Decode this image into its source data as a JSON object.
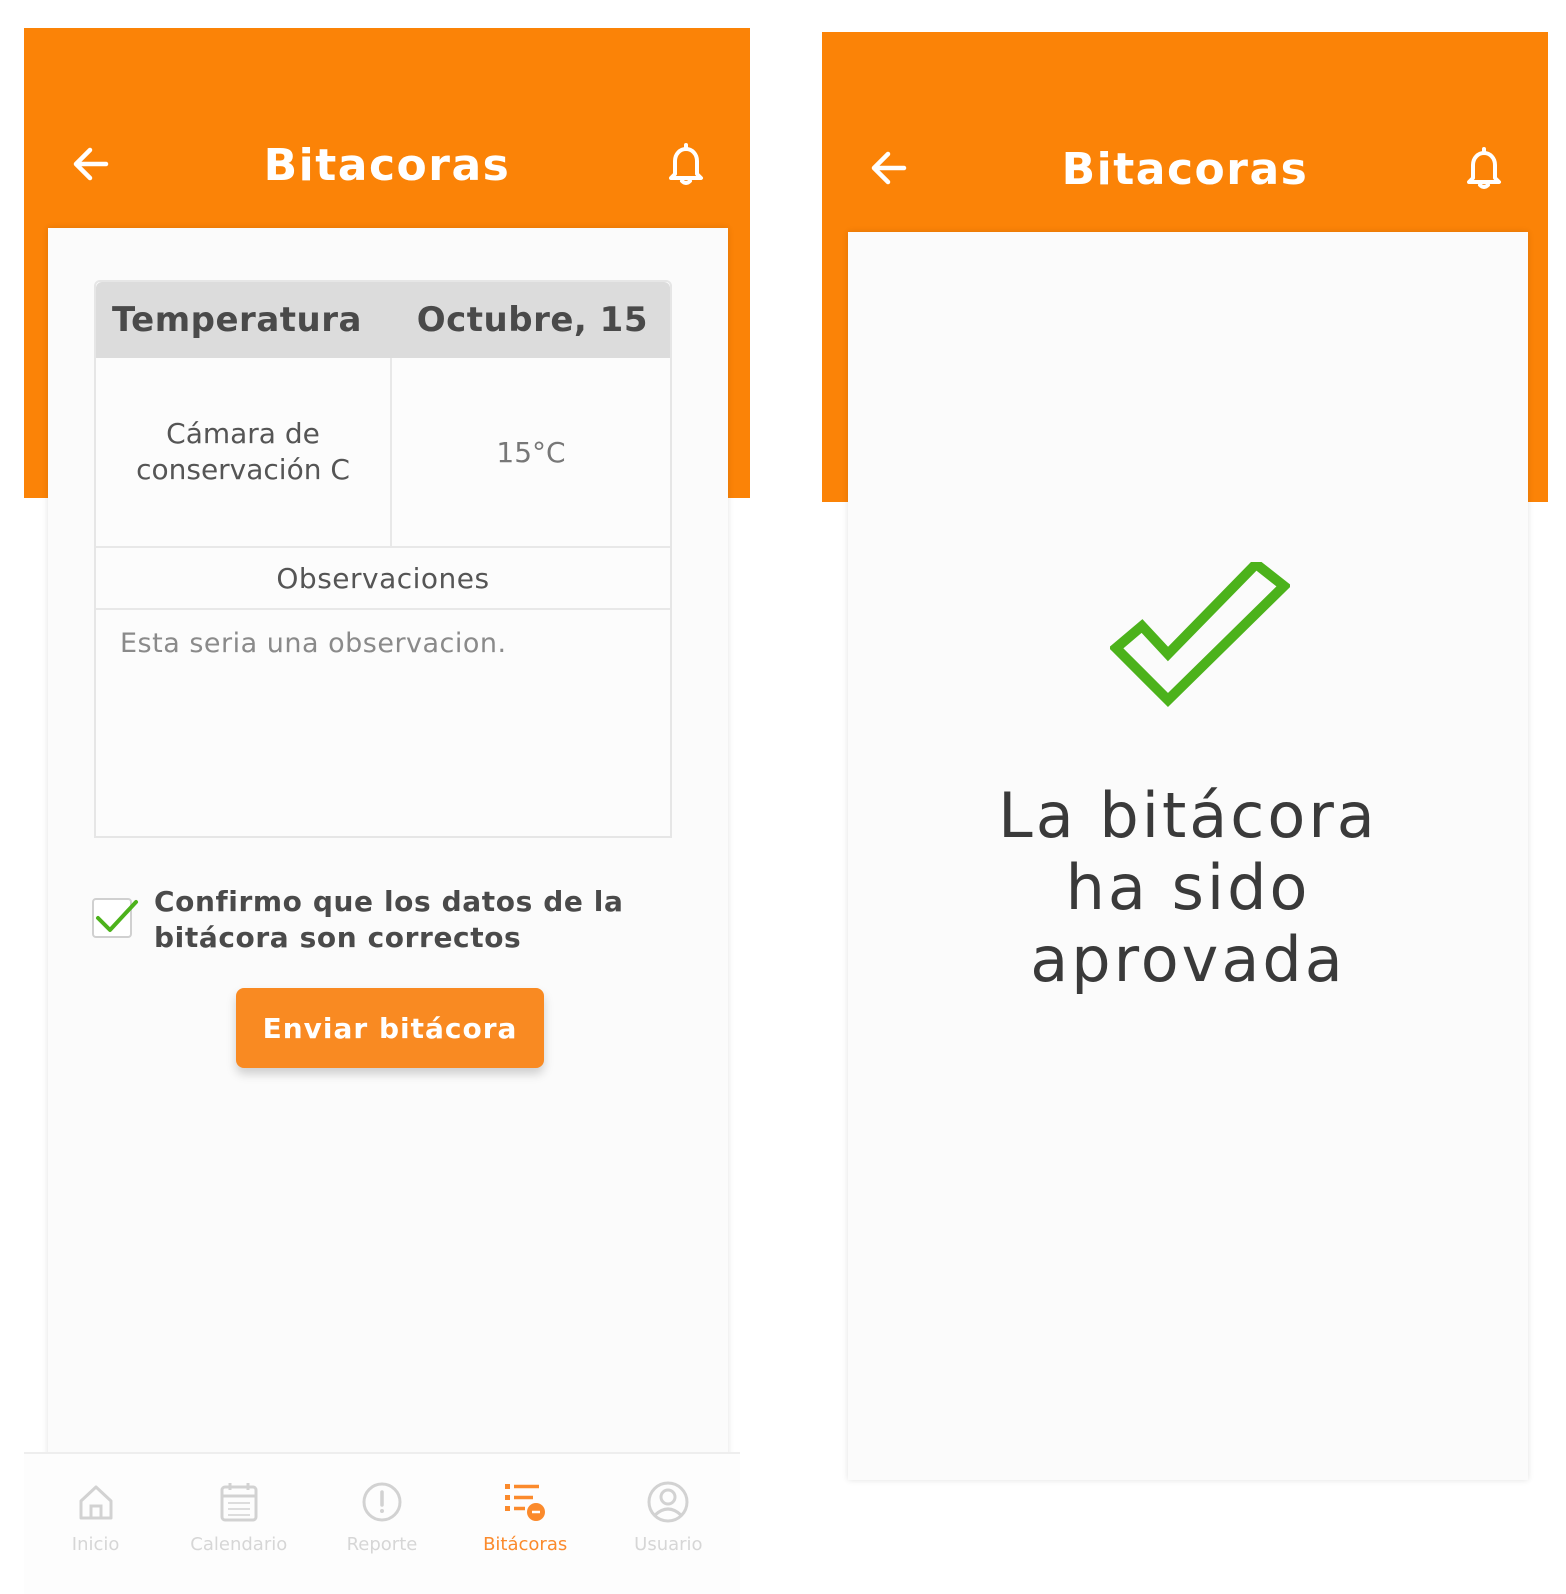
{
  "screens": [
    {
      "header": {
        "title": "Bitacoras"
      },
      "log": {
        "parameter": "Temperatura",
        "date": "Octubre, 15",
        "location": "Cámara de conservación C",
        "value": "15°C",
        "observations_label": "Observaciones",
        "observations_text": "Esta seria una observacion."
      },
      "confirm": {
        "checked": true,
        "label": "Confirmo que los datos de la bitácora son correctos"
      },
      "send_button": "Enviar bitácora",
      "nav": [
        {
          "label": "Inicio",
          "icon": "home-icon"
        },
        {
          "label": "Calendario",
          "icon": "calendar-icon"
        },
        {
          "label": "Reporte",
          "icon": "alert-icon"
        },
        {
          "label": "Bitácoras",
          "icon": "list-icon",
          "active": true
        },
        {
          "label": "Usuario",
          "icon": "user-icon"
        }
      ]
    },
    {
      "header": {
        "title": "Bitacoras"
      },
      "success": {
        "line1": "La bitácora",
        "line2": "ha sido",
        "line3": "aprovada"
      }
    }
  ],
  "colors": {
    "accent": "#fb8307",
    "button": "#f98a22",
    "success": "#4cb21b"
  }
}
